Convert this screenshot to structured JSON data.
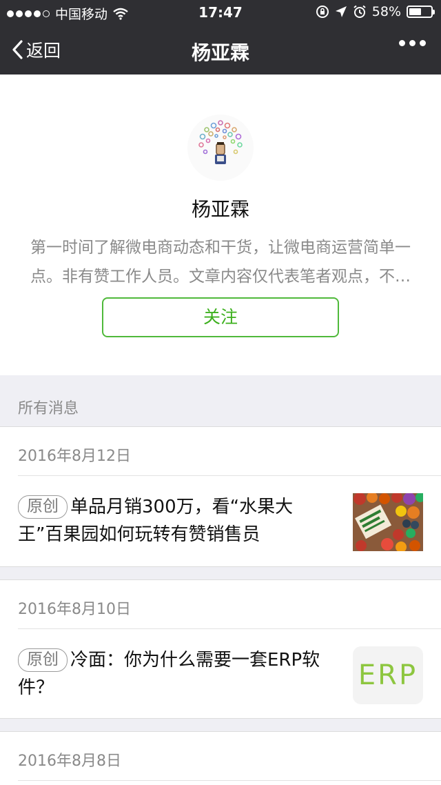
{
  "status_bar": {
    "carrier": "中国移动",
    "time": "17:47",
    "battery_text": "58%",
    "battery_level": 0.58
  },
  "nav": {
    "back_label": "返回",
    "title": "杨亚霖"
  },
  "profile": {
    "name": "杨亚霖",
    "description": "第一时间了解微电商动态和干货，让微电商运营简单一点。非有赞工作人员。文章内容仅代表笔者观点，不代表有赞官方立场。",
    "follow_label": "关注"
  },
  "section": {
    "title": "所有消息"
  },
  "messages": [
    {
      "date": "2016年8月12日",
      "tag": "原创",
      "title": "单品月销300万，看“水果大王”百果园如何玩转有赞销售员",
      "thumb": "fruit-photo"
    },
    {
      "date": "2016年8月10日",
      "tag": "原创",
      "title": "冷面：你为什么需要一套ERP软件？",
      "thumb_text": "ERP"
    },
    {
      "date": "2016年8月8日"
    }
  ],
  "colors": {
    "nav_bg": "#2f2f33",
    "accent_green": "#3db01e",
    "page_bg": "#efeff4"
  }
}
